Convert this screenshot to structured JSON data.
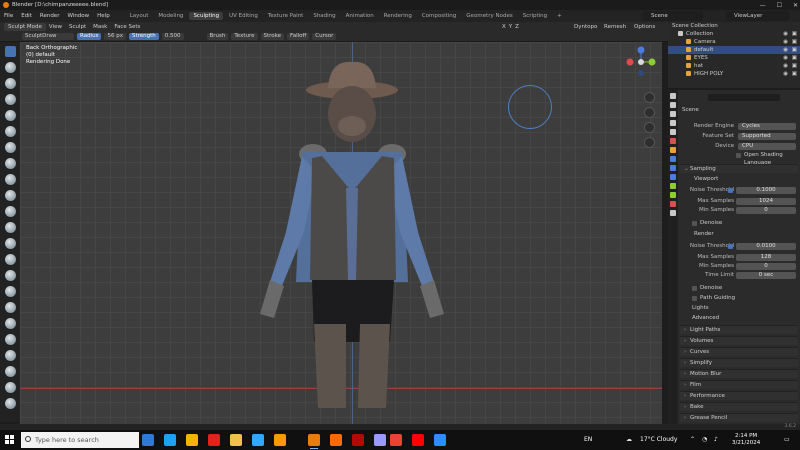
{
  "window": {
    "title": "Blender [D:\\chimpanzeeeee.blend]",
    "controls": [
      "—",
      "☐",
      "✕"
    ]
  },
  "menu": {
    "items": [
      "File",
      "Edit",
      "Render",
      "Window",
      "Help"
    ],
    "workspaces": [
      "Layout",
      "Modeling",
      "Sculpting",
      "UV Editing",
      "Texture Paint",
      "Shading",
      "Animation",
      "Rendering",
      "Compositing",
      "Geometry Nodes",
      "Scripting"
    ],
    "active_workspace": "Sculpting",
    "add_tab": "+",
    "scene": "Scene",
    "view_layer": "ViewLayer"
  },
  "header": {
    "mode": "Sculpt Mode",
    "menus": [
      "View",
      "Sculpt",
      "Mask",
      "Face Sets"
    ],
    "axes": [
      "X",
      "Y",
      "Z"
    ],
    "right": [
      "Dyntopo",
      "Remesh",
      "Options"
    ]
  },
  "tool_settings": {
    "brush": "SculptDraw",
    "radius_label": "Radius",
    "radius_value": "56 px",
    "strength_label": "Strength",
    "strength_value": "0.500",
    "menus": [
      "Brush",
      "Texture",
      "Stroke",
      "Falloff",
      "Cursor"
    ]
  },
  "viewport": {
    "info": [
      "Back Orthographic",
      "(0) default",
      "Rendering Done"
    ],
    "gizmo": {
      "x": "X",
      "y": "Y",
      "z": "Z"
    }
  },
  "outliner": {
    "rows": [
      {
        "label": "Scene Collection",
        "depth": 0,
        "color": "#b0b0b0"
      },
      {
        "label": "Collection",
        "depth": 1,
        "color": "#b0b0b0"
      },
      {
        "label": "Camera",
        "depth": 2,
        "color": "#e8a23a"
      },
      {
        "label": "default",
        "depth": 2,
        "color": "#e8a23a",
        "selected": true
      },
      {
        "label": "EYES",
        "depth": 2,
        "color": "#e8a23a"
      },
      {
        "label": "hat",
        "depth": 2,
        "color": "#e8a23a"
      },
      {
        "label": "HIGH POLY",
        "depth": 2,
        "color": "#e8a23a"
      }
    ]
  },
  "properties": {
    "scene_label": "Scene",
    "render_engine_label": "Render Engine",
    "render_engine": "Cycles",
    "feature_set_label": "Feature Set",
    "feature_set": "Supported",
    "device_label": "Device",
    "device": "CPU",
    "osl": "Open Shading Language",
    "sampling": "Sampling",
    "viewport_sub": "Viewport",
    "noise_threshold_label": "Noise Threshold",
    "viewport_noise": "0.1000",
    "max_samples_label": "Max Samples",
    "viewport_max": "1024",
    "min_samples_label": "Min Samples",
    "viewport_min": "0",
    "denoise": "Denoise",
    "render_sub": "Render",
    "render_noise": "0.0100",
    "render_max": "128",
    "render_min": "0",
    "time_limit_label": "Time Limit",
    "time_limit": "0 sec",
    "denoise2": "Denoise",
    "path_guiding": "Path Guiding",
    "lights": "Lights",
    "advanced": "Advanced",
    "sections": [
      "Light Paths",
      "Volumes",
      "Curves",
      "Simplify",
      "Motion Blur",
      "Film",
      "Performance",
      "Bake",
      "Grease Pencil"
    ]
  },
  "status": {
    "version": "3.6.2"
  },
  "taskbar": {
    "search_placeholder": "Type here to search",
    "language": "EN",
    "weather": "17°C  Cloudy",
    "time": "2:14 PM",
    "date": "3/21/2024",
    "apps": [
      "#2c7ad6",
      "#1da1f2",
      "#f4b400",
      "#e2231a",
      "#f0c24b",
      "#31a8ff",
      "#ff9a00",
      "#e87d0d",
      "#ff6a00",
      "#b30b00",
      "#9999ff",
      "#ea4335",
      "#ff0000",
      "#2d8cff"
    ]
  },
  "colors": {
    "accent": "#4772b3",
    "blender_orange": "#e87d0d",
    "x_axis": "#e24a4a",
    "y_axis": "#8ccd33",
    "z_axis": "#4a7ce2"
  }
}
